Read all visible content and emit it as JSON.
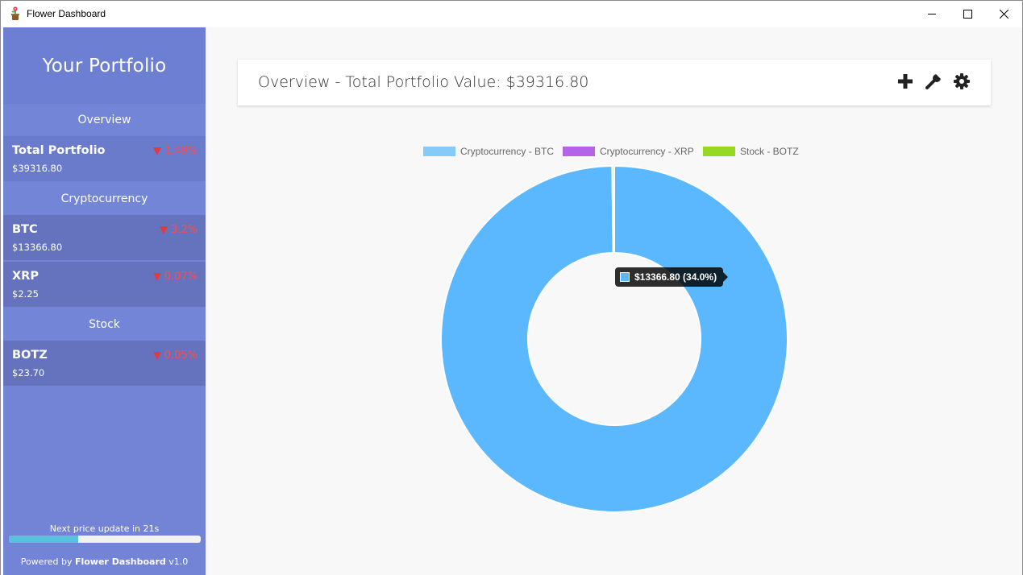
{
  "window": {
    "title": "Flower Dashboard",
    "icon": "flower-pot-icon",
    "controls": [
      "minimize-icon",
      "maximize-icon",
      "close-icon"
    ]
  },
  "sidebar": {
    "title": "Your Portfolio",
    "sections": [
      {
        "label": "Overview",
        "items": [
          {
            "name": "Total Portfolio",
            "value": "$39316.80",
            "change": "1.49%",
            "direction": "down"
          }
        ]
      },
      {
        "label": "Cryptocurrency",
        "items": [
          {
            "name": "BTC",
            "value": "$13366.80",
            "change": "3.2%",
            "direction": "down"
          },
          {
            "name": "XRP",
            "value": "$2.25",
            "change": "0.07%",
            "direction": "down"
          }
        ]
      },
      {
        "label": "Stock",
        "items": [
          {
            "name": "BOTZ",
            "value": "$23.70",
            "change": "0.05%",
            "direction": "down"
          }
        ]
      }
    ],
    "update_text": "Next price update in 21s",
    "update_progress": 0.36,
    "powered_prefix": "Powered by",
    "powered_name": "Flower Dashboard",
    "powered_version": "v1.0"
  },
  "header": {
    "title": "Overview - Total Portfolio Value: $39316.80",
    "tools": [
      "plus-icon",
      "wrench-icon",
      "gear-icon"
    ]
  },
  "colors": {
    "sidebar": "#7383d5",
    "btc": "#5bb8ff",
    "xrp": "#b464e8",
    "botz": "#95d923",
    "legend_btc": "#86cafa",
    "negative": "#ff4b4b"
  },
  "tooltip": {
    "text": "$13366.80 (34.0%)",
    "series": "Cryptocurrency - BTC"
  },
  "chart_data": {
    "type": "pie",
    "subtype": "doughnut",
    "labels": [
      "Cryptocurrency - BTC",
      "Cryptocurrency - XRP",
      "Stock - BOTZ"
    ],
    "values": [
      13366.8,
      2.25,
      23.7
    ],
    "legend": "top"
  }
}
